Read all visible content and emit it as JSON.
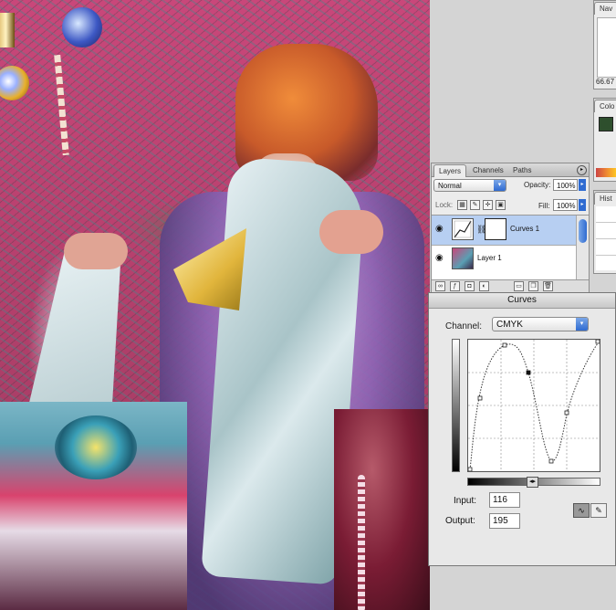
{
  "navigator": {
    "tab_label": "Nav",
    "zoom_value": "66.67"
  },
  "color_panel": {
    "tab_label": "Colo",
    "foreground_color": "#2e4f2d"
  },
  "history_panel": {
    "tab_label": "Hist"
  },
  "layers": {
    "tabs": [
      {
        "label": "Layers"
      },
      {
        "label": "Channels"
      },
      {
        "label": "Paths"
      }
    ],
    "blend_mode": "Normal",
    "opacity_label": "Opacity:",
    "opacity_value": "100%",
    "lock_label": "Lock:",
    "fill_label": "Fill:",
    "fill_value": "100%",
    "items": [
      {
        "name": "Curves 1",
        "selected": true
      },
      {
        "name": "Layer 1",
        "selected": false
      }
    ]
  },
  "curves": {
    "title": "Curves",
    "channel_label": "Channel:",
    "channel_value": "CMYK",
    "input_label": "Input:",
    "input_value": "116",
    "output_label": "Output:",
    "output_value": "195"
  },
  "colors": {
    "selection_blue": "#b7cff2",
    "accent_blue": "#2f6bd1",
    "panel_bg": "#ececec"
  }
}
